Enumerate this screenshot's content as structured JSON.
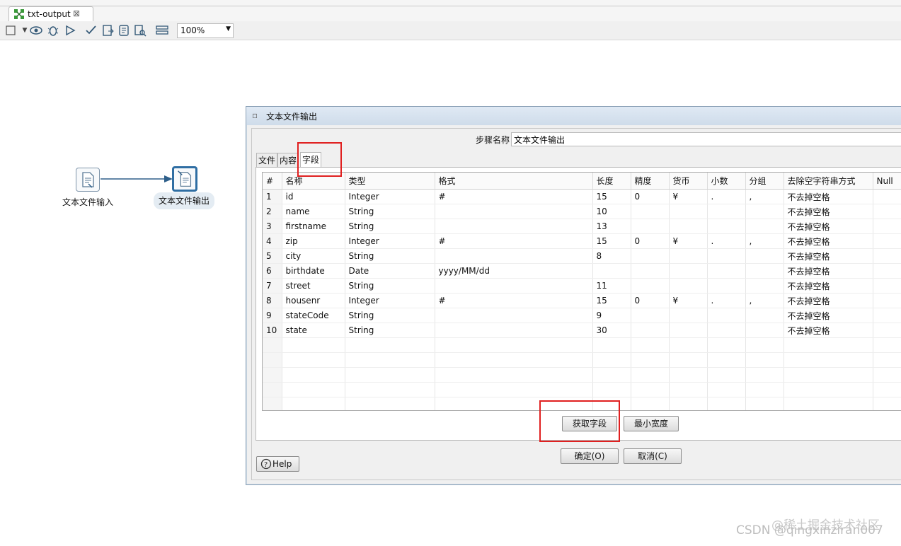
{
  "editor": {
    "tab_title": "txt-output",
    "tab_close": "⊠"
  },
  "toolbar": {
    "icons": [
      "stop-icon",
      "preview-icon",
      "debug-icon",
      "replay-icon",
      "verify-icon",
      "impact-icon",
      "sql-icon",
      "explore-db-icon",
      "layout-icon"
    ],
    "zoom": "100%"
  },
  "canvas": {
    "nodes": [
      {
        "label": "文本文件输入"
      },
      {
        "label": "文本文件输出"
      }
    ]
  },
  "dialog": {
    "title": "文本文件输出",
    "step_name_label": "步骤名称",
    "step_name_value": "文本文件输出",
    "tabs": [
      "文件",
      "内容",
      "字段"
    ],
    "active_tab": "字段",
    "grid": {
      "headers": [
        "#",
        "名称",
        "类型",
        "格式",
        "长度",
        "精度",
        "货币",
        "小数",
        "分组",
        "去除空字符串方式",
        "Null"
      ],
      "rows": [
        [
          "1",
          "id",
          "Integer",
          "#",
          "15",
          "0",
          "¥",
          ".",
          ",",
          "不去掉空格",
          ""
        ],
        [
          "2",
          "name",
          "String",
          "",
          "10",
          "",
          "",
          "",
          "",
          "不去掉空格",
          ""
        ],
        [
          "3",
          "firstname",
          "String",
          "",
          "13",
          "",
          "",
          "",
          "",
          "不去掉空格",
          ""
        ],
        [
          "4",
          "zip",
          "Integer",
          "#",
          "15",
          "0",
          "¥",
          ".",
          ",",
          "不去掉空格",
          ""
        ],
        [
          "5",
          "city",
          "String",
          "",
          "8",
          "",
          "",
          "",
          "",
          "不去掉空格",
          ""
        ],
        [
          "6",
          "birthdate",
          "Date",
          "yyyy/MM/dd",
          "",
          "",
          "",
          "",
          "",
          "不去掉空格",
          ""
        ],
        [
          "7",
          "street",
          "String",
          "",
          "11",
          "",
          "",
          "",
          "",
          "不去掉空格",
          ""
        ],
        [
          "8",
          "housenr",
          "Integer",
          "#",
          "15",
          "0",
          "¥",
          ".",
          ",",
          "不去掉空格",
          ""
        ],
        [
          "9",
          "stateCode",
          "String",
          "",
          "9",
          "",
          "",
          "",
          "",
          "不去掉空格",
          ""
        ],
        [
          "10",
          "state",
          "String",
          "",
          "30",
          "",
          "",
          "",
          "",
          "不去掉空格",
          ""
        ]
      ]
    },
    "get_fields_button": "获取字段",
    "min_width_button": "最小宽度",
    "ok_button": "确定(O)",
    "cancel_button": "取消(C)",
    "help_button": "Help"
  },
  "watermark": {
    "line1": "@稀土掘金技术社区",
    "line2": "CSDN @qingxinziran007"
  },
  "colors": {
    "highlight": "#e02020",
    "node_selected": "#2f6ea3"
  }
}
